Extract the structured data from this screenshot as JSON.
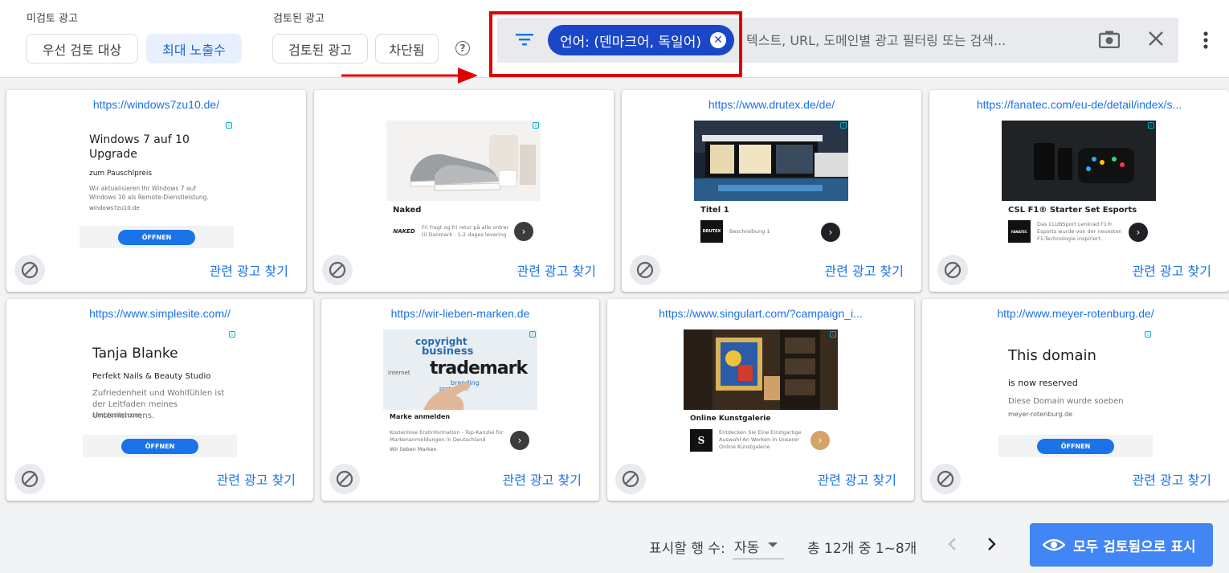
{
  "toolbar": {
    "unreviewed_group_label": "미검토 광고",
    "priority_review_chip": "우선 검토 대상",
    "max_impressions_chip": "최대 노출수",
    "reviewed_group_label": "검토된 광고",
    "reviewed_ads_chip": "검토된 광고",
    "blocked_chip": "차단됨",
    "help_icon": "help-icon"
  },
  "filter": {
    "language_chip_label": "언어: (덴마크어, 독일어)",
    "search_placeholder": "텍스트, URL, 도메인별 광고 필터링 또는 검색...",
    "filter_icon": "filter-icon",
    "camera_icon": "camera-icon",
    "clear_icon": "close-icon",
    "more_icon": "more-vert-icon",
    "highlight_color": "#e00000"
  },
  "cards": [
    {
      "url": "https://windows7zu10.de/",
      "ad": {
        "title": "Windows 7 auf 10 Upgrade",
        "subtitle": "zum Pauschlpreis",
        "description": "Wir aktualisieren Ihr Windows 7 auf Windows 10 als Remote-Dienstleistung.",
        "domain": "windows7zu10.de",
        "button": "ÖFFNEN"
      },
      "related_label": "관련 광고 찾기"
    },
    {
      "url": "",
      "ad": {
        "title": "Naked",
        "logo": "NAKED",
        "description": "Fri fragt og fri retur på alle ordrer til Danmark - 1-2 dages levering"
      },
      "related_label": "관련 광고 찾기"
    },
    {
      "url": "https://www.drutex.de/de/",
      "ad": {
        "title": "Titel 1",
        "logo": "DRUTEX",
        "description": "Beschreibung 1"
      },
      "related_label": "관련 광고 찾기"
    },
    {
      "url": "https://fanatec.com/eu-de/detail/index/s...",
      "ad": {
        "title": "CSL F1® Starter Set Esports",
        "logo": "FANATEC",
        "description": "Das CLUBSport Lenkrad F1® Esports wurde von der neuesten F1-Technologie inspiriert."
      },
      "related_label": "관련 광고 찾기"
    },
    {
      "url": "https://www.simplesite.com//",
      "ad": {
        "title": "Tanja Blanke",
        "subtitle": "Perfekt Nails & Beauty Studio",
        "description": "Zufriedenheit und Wohlfühlen ist der Leitfaden meines Unternehmens.",
        "domain": "simplesite.com",
        "button": "ÖFFNEN"
      },
      "related_label": "관련 광고 찾기"
    },
    {
      "url": "https://wir-lieben-marken.de",
      "ad": {
        "title": "Marke anmelden",
        "description": "Kostenlose Erstinformation - Top-Kanzlei für Markenanmeldungen in Deutschland",
        "domain": "Wir lieben Marken",
        "image_words": [
          "copyright",
          "business",
          "trademark",
          "branding",
          "internet",
          "protection"
        ]
      },
      "related_label": "관련 광고 찾기"
    },
    {
      "url": "https://www.singulart.com/?campaign_i...",
      "ad": {
        "title": "Online Kunstgalerie",
        "logo": "S",
        "description": "Entdecken Sie Eine Einzigartige Auswahl An Werken In Unserer Online Kunstgalerie"
      },
      "related_label": "관련 광고 찾기"
    },
    {
      "url": "http://www.meyer-rotenburg.de/",
      "ad": {
        "title": "This domain",
        "subtitle": "is now reserved",
        "description": "Diese Domain wurde soeben",
        "domain": "meyer-rotenburg.de",
        "button": "ÖFFNEN"
      },
      "related_label": "관련 광고 찾기"
    }
  ],
  "footer": {
    "rows_label": "표시할 행 수:",
    "rows_value": "자동",
    "range_text": "총 12개 중 1~8개",
    "review_all_label": "모두 검토됨으로 표시"
  }
}
